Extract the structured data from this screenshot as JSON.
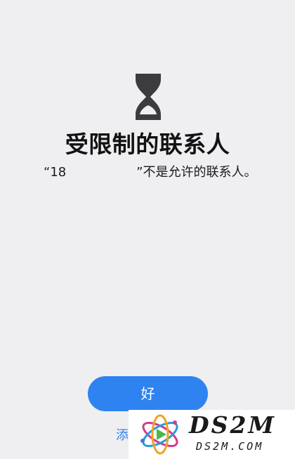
{
  "dialog": {
    "icon": "hourglass-icon",
    "title": "受限制的联系人",
    "message_prefix": "“18",
    "message_suffix": "”不是允许的联系人。",
    "ok_button_label": "好",
    "add_link_label": "添"
  },
  "watermark": {
    "main_text": "DS2M",
    "sub_text": "DS2M.COM"
  },
  "colors": {
    "background": "#efeff1",
    "accent": "#2f83f0",
    "text": "#121212"
  }
}
